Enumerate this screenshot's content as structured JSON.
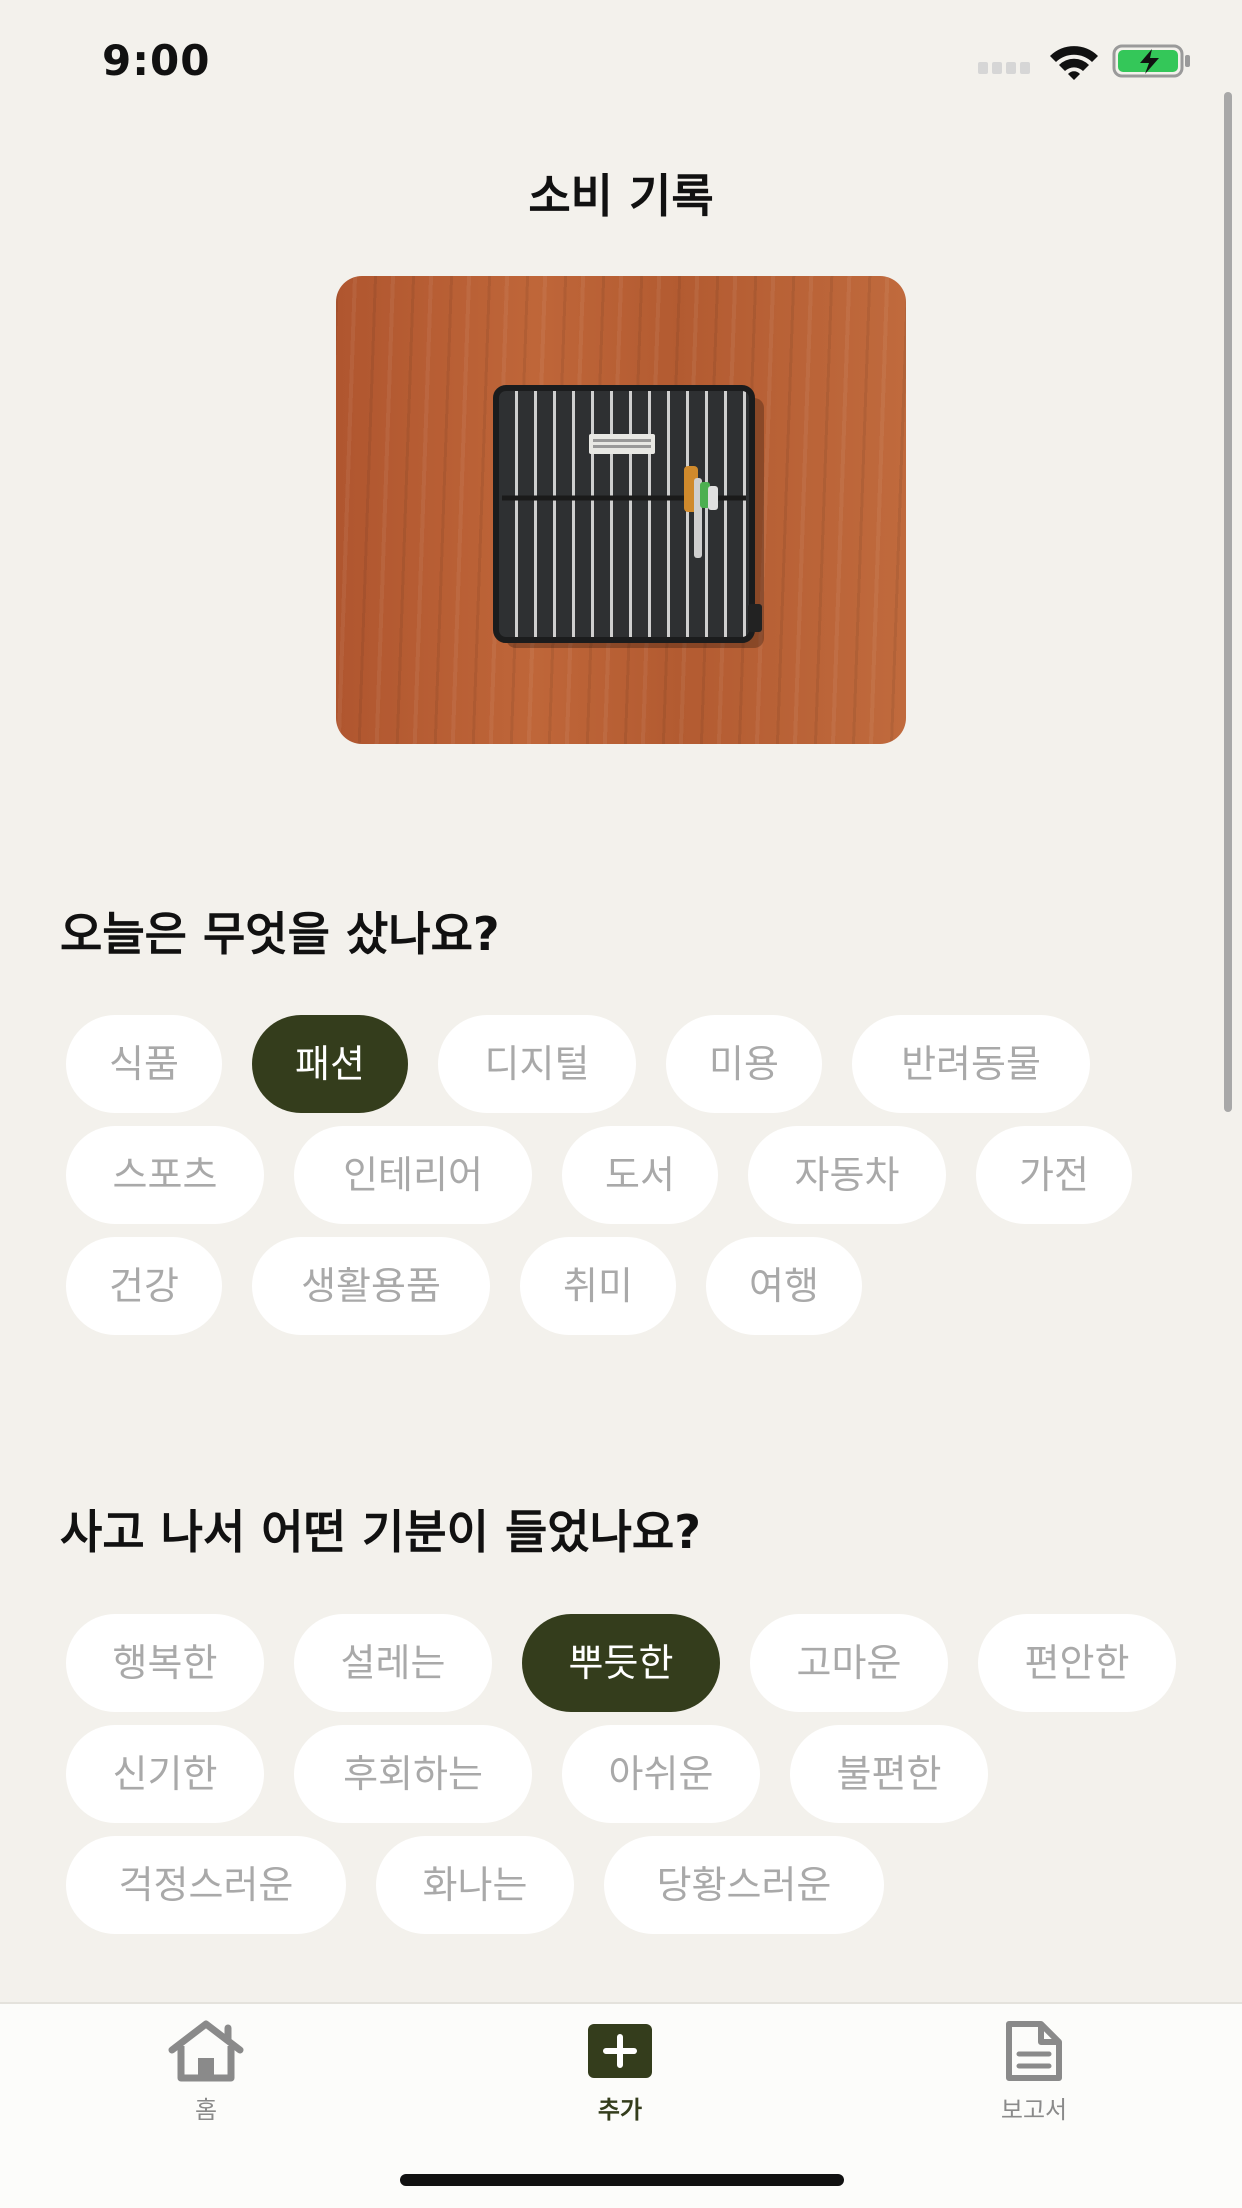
{
  "status": {
    "time": "9:00"
  },
  "page": {
    "title": "소비 기록"
  },
  "category_section": {
    "title": "오늘은 무엇을 샀나요?",
    "chips": [
      "식품",
      "패션",
      "디지털",
      "미용",
      "반려동물",
      "스포츠",
      "인테리어",
      "도서",
      "자동차",
      "가전",
      "건강",
      "생활용품",
      "취미",
      "여행"
    ],
    "selected": "패션"
  },
  "mood_section": {
    "title": "사고 나서 어떤 기분이 들었나요?",
    "chips": [
      "행복한",
      "설레는",
      "뿌듯한",
      "고마운",
      "편안한",
      "신기한",
      "후회하는",
      "아쉬운",
      "불편한",
      "걱정스러운",
      "화나는",
      "당황스러운"
    ],
    "selected": "뿌듯한"
  },
  "tab_bar": {
    "items": [
      {
        "label": "홈",
        "icon": "home-icon",
        "active": false
      },
      {
        "label": "추가",
        "icon": "plus-icon",
        "active": true
      },
      {
        "label": "보고서",
        "icon": "document-icon",
        "active": false
      }
    ]
  },
  "colors": {
    "background": "#f3f1ec",
    "accent": "#343d1c",
    "chip": "#ffffff",
    "chip_text": "#a9a9a9"
  }
}
